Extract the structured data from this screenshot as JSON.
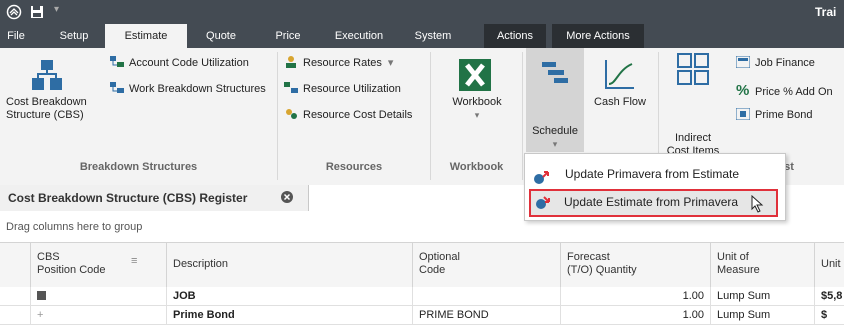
{
  "titlebar": {
    "title_partial": "Trai"
  },
  "menu": {
    "items": [
      "File",
      "Setup",
      "Estimate",
      "Quote",
      "Price",
      "Execution",
      "System",
      "Actions",
      "More Actions"
    ]
  },
  "ribbon": {
    "cbs_label": "Cost Breakdown\nStructure (CBS)",
    "account_code": "Account Code Utilization",
    "wbs": "Work Breakdown Structures",
    "resource_rates": "Resource Rates",
    "resource_util": "Resource Utilization",
    "resource_cost": "Resource Cost Details",
    "workbook": "Workbook",
    "schedule": "Schedule",
    "cashflow": "Cash Flow",
    "indirect": "Indirect\nCost Items",
    "job_finance": "Job Finance",
    "price_add": "Price % Add On",
    "prime_bond": "Prime Bond",
    "groups": {
      "breakdown": "Breakdown Structures",
      "resources": "Resources",
      "workbook": "Workbook",
      "cost_partial": "st"
    }
  },
  "dropdown": {
    "items": [
      "Update Primavera from Estimate",
      "Update Estimate from Primavera"
    ]
  },
  "doctab": {
    "title": "Cost Breakdown Structure (CBS) Register"
  },
  "grid": {
    "group_hint": "Drag columns here to group",
    "headers": [
      "CBS\nPosition Code",
      "Description",
      "Optional\nCode",
      "Forecast\n(T/O) Quantity",
      "Unit of\nMeasure",
      "Unit"
    ],
    "rows": [
      {
        "code": "",
        "description": "JOB",
        "optional": "",
        "qty": "1.00",
        "uom": "Lump Sum",
        "unit": "$5,8"
      },
      {
        "code": "+",
        "description": "Prime Bond",
        "optional": "PRIME BOND",
        "qty": "1.00",
        "uom": "Lump Sum",
        "unit": "$"
      }
    ]
  },
  "colors": {
    "titlebar": "#444b53",
    "accent": "#217346",
    "highlight": "#e0303a"
  }
}
